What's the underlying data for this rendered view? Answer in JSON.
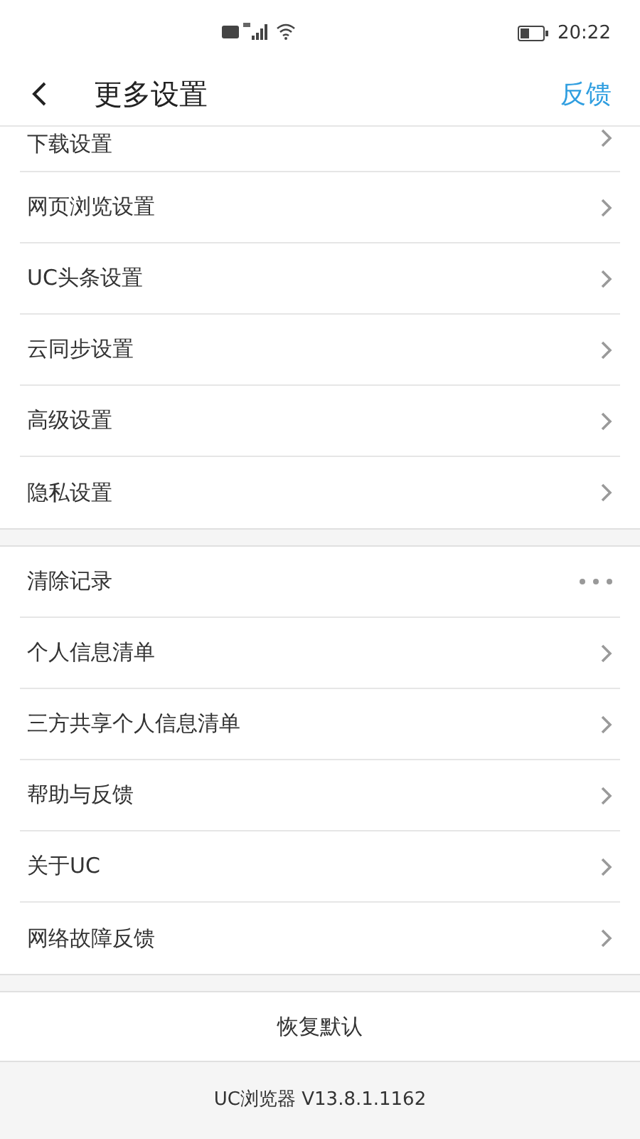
{
  "status_bar": {
    "time": "20:22"
  },
  "header": {
    "title": "更多设置",
    "action": "反馈"
  },
  "groups": [
    {
      "items": [
        {
          "label": "下载设置",
          "kind": "arrow"
        },
        {
          "label": "网页浏览设置",
          "kind": "arrow"
        },
        {
          "label": "UC头条设置",
          "kind": "arrow"
        },
        {
          "label": "云同步设置",
          "kind": "arrow"
        },
        {
          "label": "高级设置",
          "kind": "arrow"
        },
        {
          "label": "隐私设置",
          "kind": "arrow"
        }
      ]
    },
    {
      "items": [
        {
          "label": "清除记录",
          "kind": "more"
        },
        {
          "label": "个人信息清单",
          "kind": "arrow"
        },
        {
          "label": "三方共享个人信息清单",
          "kind": "arrow"
        },
        {
          "label": "帮助与反馈",
          "kind": "arrow"
        },
        {
          "label": "关于UC",
          "kind": "arrow"
        },
        {
          "label": "网络故障反馈",
          "kind": "arrow"
        }
      ]
    }
  ],
  "restore_button": "恢复默认",
  "version": "UC浏览器 V13.8.1.1162"
}
